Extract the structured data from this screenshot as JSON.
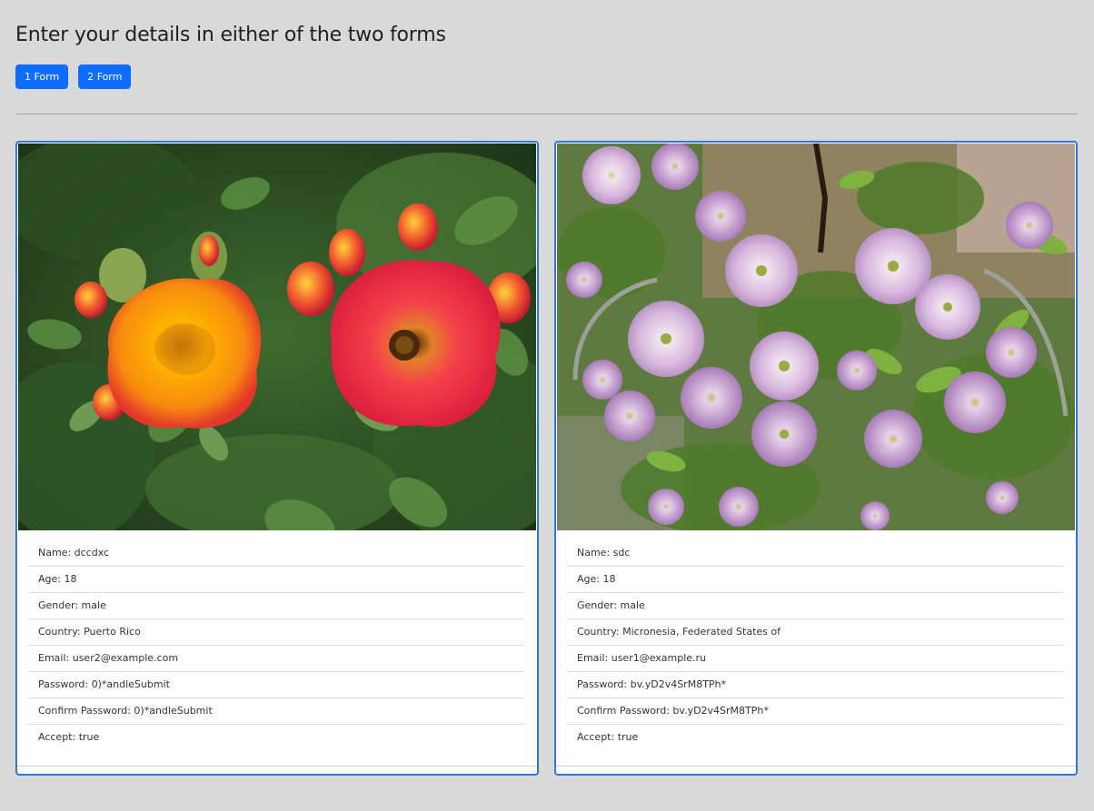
{
  "header": {
    "title": "Enter your details in either of the two forms",
    "tabs": [
      {
        "label": "1 Form"
      },
      {
        "label": "2 Form"
      }
    ]
  },
  "cards": [
    {
      "image": "red-orange-roses-photo",
      "fields": [
        {
          "text": "Name: dccdxc"
        },
        {
          "text": "Age: 18"
        },
        {
          "text": "Gender: male"
        },
        {
          "text": "Country: Puerto Rico"
        },
        {
          "text": "Email: user2@example.com"
        },
        {
          "text": "Password: 0)*andleSubmit"
        },
        {
          "text": "Confirm Password: 0)*andleSubmit"
        },
        {
          "text": "Accept: true"
        }
      ]
    },
    {
      "image": "pink-clematis-flowers-photo",
      "fields": [
        {
          "text": "Name: sdc"
        },
        {
          "text": "Age: 18"
        },
        {
          "text": "Gender: male"
        },
        {
          "text": "Country: Micronesia, Federated States of"
        },
        {
          "text": "Email: user1@example.ru"
        },
        {
          "text": "Password: bv.yD2v4SrM8TPh*"
        },
        {
          "text": "Confirm Password: bv.yD2v4SrM8TPh*"
        },
        {
          "text": "Accept: true"
        }
      ]
    }
  ],
  "colors": {
    "background": "#d9d9d9",
    "accent": "#0d6efd",
    "card_border": "#2f78d8"
  }
}
